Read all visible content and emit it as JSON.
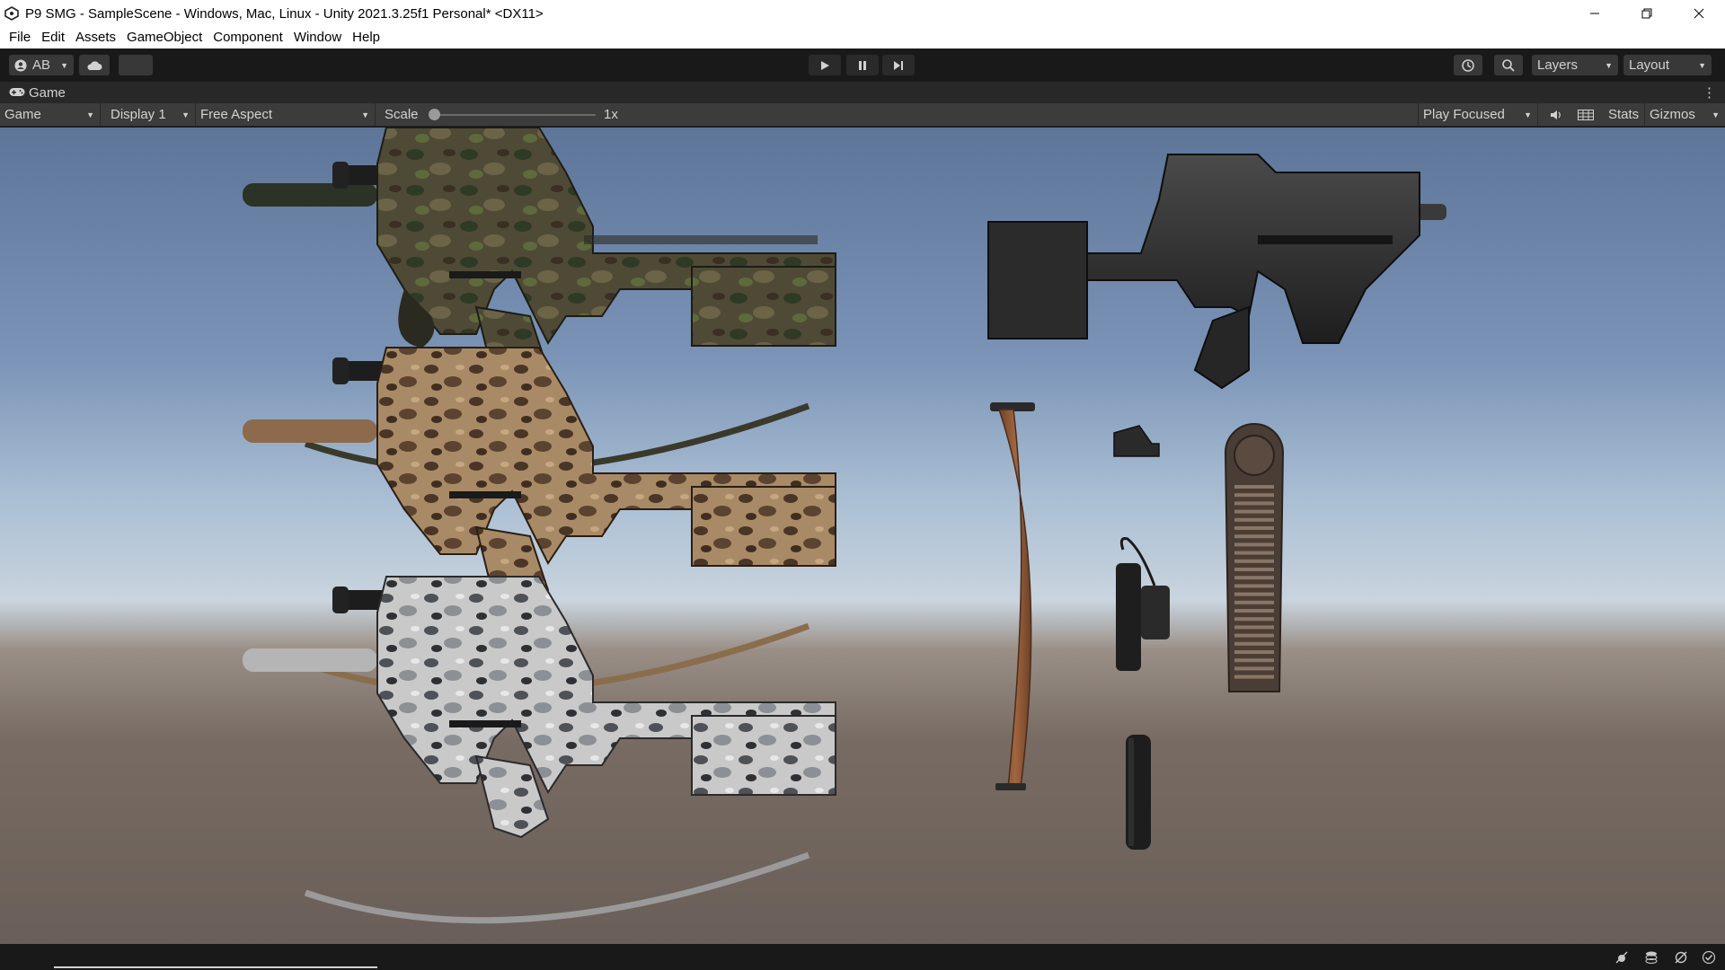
{
  "window": {
    "title": "P9 SMG - SampleScene - Windows, Mac, Linux - Unity 2021.3.25f1 Personal* <DX11>",
    "minimize_icon": "minimize-icon",
    "maximize_icon": "restore-icon",
    "close_icon": "close-icon"
  },
  "menu": {
    "items": [
      "File",
      "Edit",
      "Assets",
      "GameObject",
      "Component",
      "Window",
      "Help"
    ]
  },
  "toolbar": {
    "account_label": "AB",
    "layers_label": "Layers",
    "layout_label": "Layout",
    "play_icon": "play-icon",
    "pause_icon": "pause-icon",
    "step_icon": "step-icon"
  },
  "game_tab": {
    "label": "Game"
  },
  "game_toolbar": {
    "mode_label": "Game",
    "display_label": "Display 1",
    "aspect_label": "Free Aspect",
    "scale_label": "Scale",
    "scale_value": "1x",
    "scale_level": 0.0,
    "play_focused_label": "Play Focused",
    "stats_label": "Stats",
    "gizmos_label": "Gizmos"
  },
  "scene": {
    "objects": [
      "green-camo-p9-smg",
      "tan-camo-p9-smg",
      "snow-camo-p9-smg",
      "black-p9-smg",
      "sling",
      "red-dot-sight",
      "flashlight",
      "magazine",
      "suppressor"
    ]
  },
  "colors": {
    "editor_bg": "#191919",
    "panel_bg": "#3c3c3c",
    "sky_top": "#5d7598",
    "horizon": "#c9d4de",
    "ground": "#6a5f58"
  }
}
